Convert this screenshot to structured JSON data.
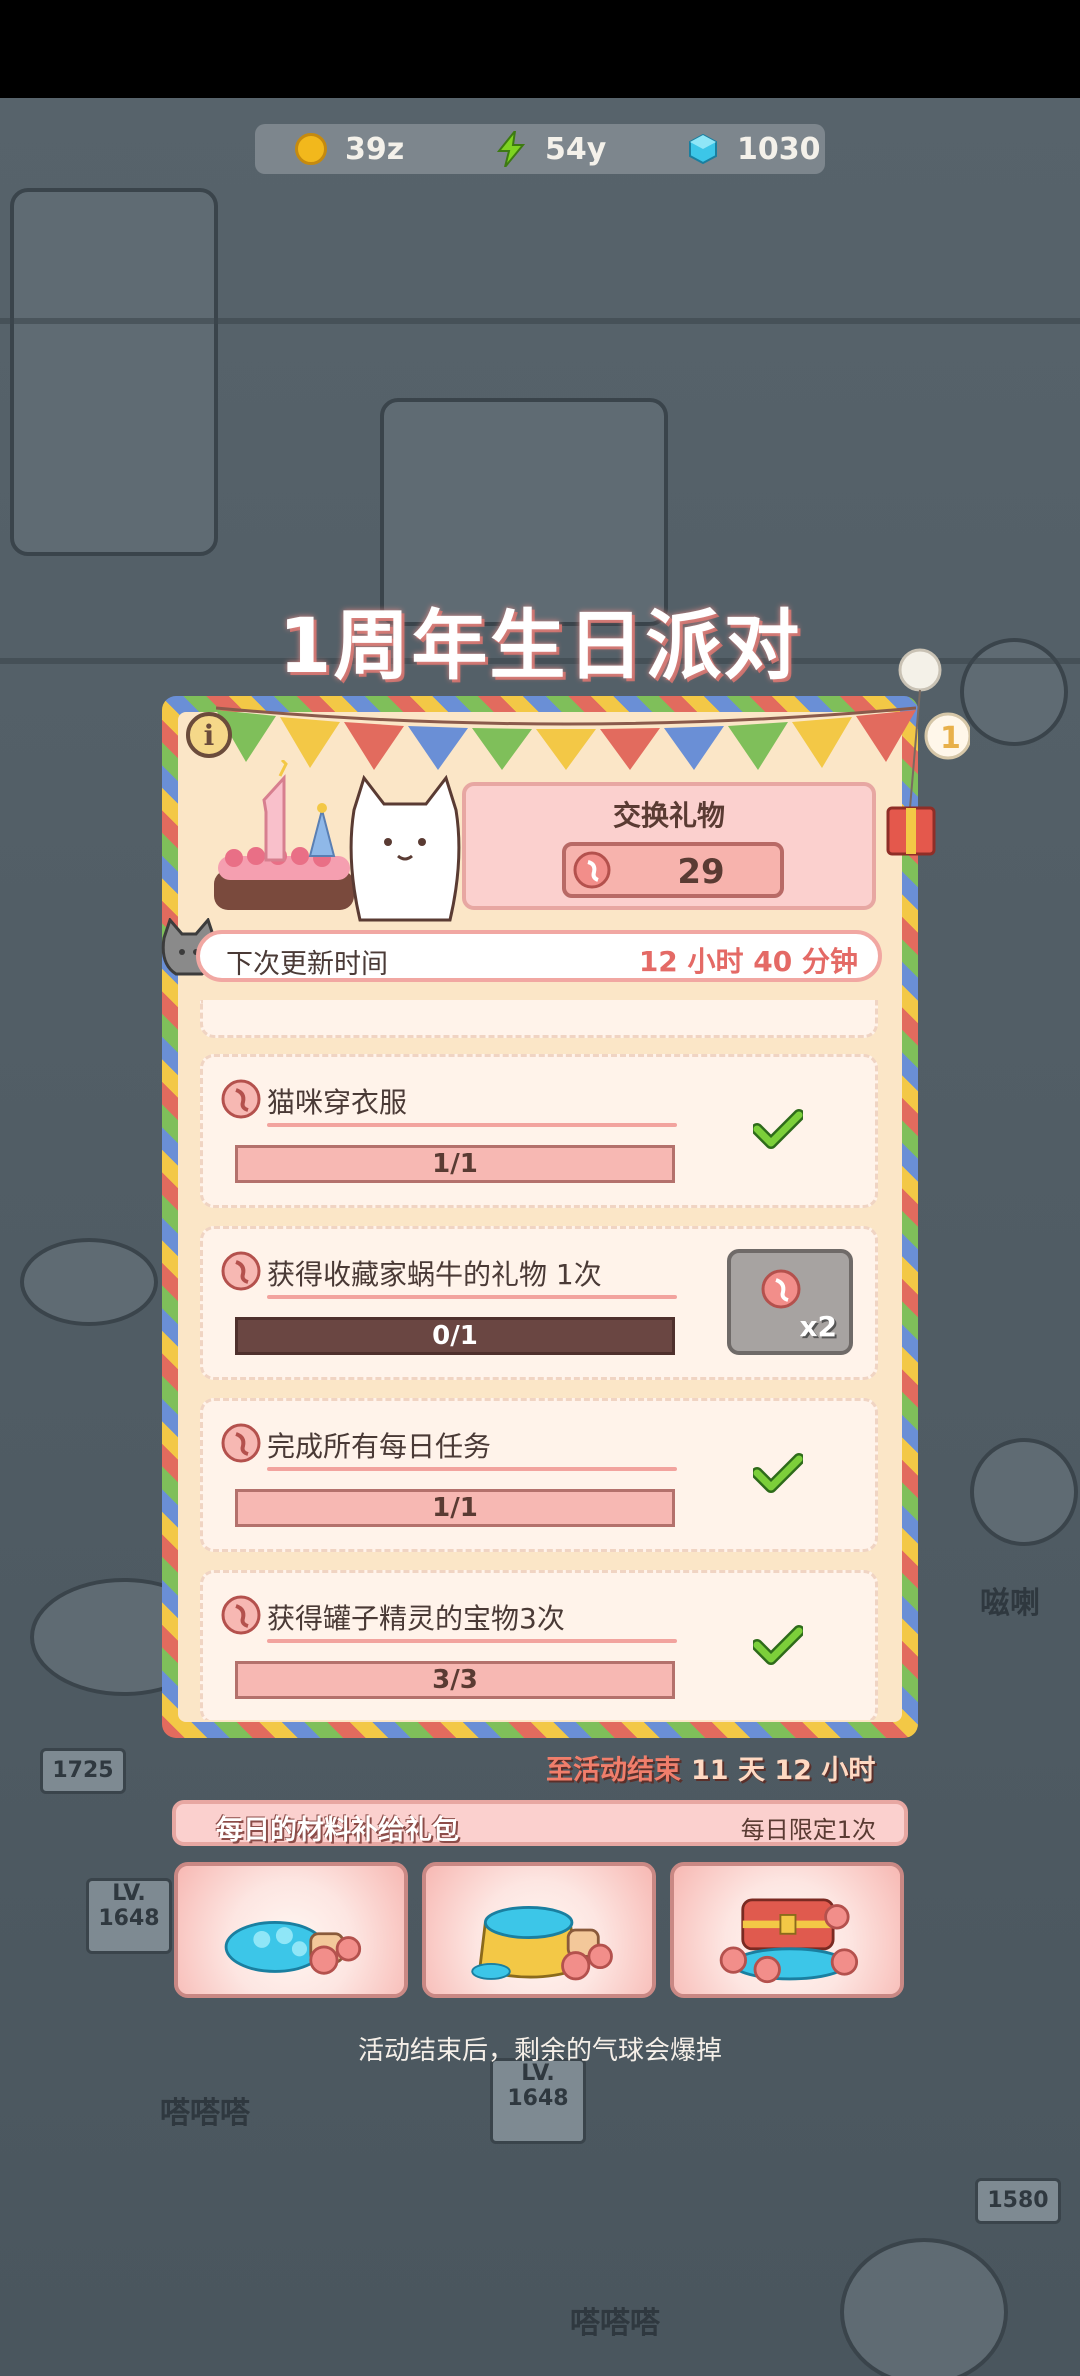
{
  "status_bar": {},
  "currency": {
    "coins": "39z",
    "energy": "54y",
    "gems": "1030"
  },
  "event": {
    "title": "1周年生日派对",
    "info_label": "i"
  },
  "exchange": {
    "title": "交换礼物",
    "count": "29"
  },
  "refresh": {
    "label": "下次更新时间",
    "time": "12 小时 40 分钟"
  },
  "tasks": [
    {
      "title": "猫咪穿衣服",
      "progress_text": "1/1",
      "progress": 1.0,
      "status": "completed"
    },
    {
      "title": "获得收藏家蜗牛的礼物 1次",
      "progress_text": "0/1",
      "progress": 0.0,
      "status": "claimable",
      "reward_multiplier": "x2"
    },
    {
      "title": "完成所有每日任务",
      "progress_text": "1/1",
      "progress": 1.0,
      "status": "completed"
    },
    {
      "title": "获得罐子精灵的宝物3次",
      "progress_text": "3/3",
      "progress": 1.0,
      "status": "completed"
    }
  ],
  "countdown": {
    "label": "至活动结束",
    "value": "11 天 12 小时"
  },
  "daily_pack": {
    "title": "每日的材料补给礼包",
    "limit": "每日限定1次",
    "packs": [
      {
        "icon": "gems-and-balloons-pack-icon"
      },
      {
        "icon": "gem-sack-pack-icon"
      },
      {
        "icon": "treasure-chest-pack-icon"
      }
    ]
  },
  "footnote": "活动结束后，剩余的气球会爆掉",
  "scene_signs": [
    "1725",
    "LV.",
    "1648",
    "LV.",
    "1648",
    "1580",
    "嗞喇",
    "嗒嗒嗒",
    "嗒嗒嗒"
  ],
  "colors": {
    "accent_pink": "#f7b8b3",
    "accent_red": "#e46a66",
    "check_green": "#7ccf3a",
    "panel_bg": "#fbe6c7"
  }
}
